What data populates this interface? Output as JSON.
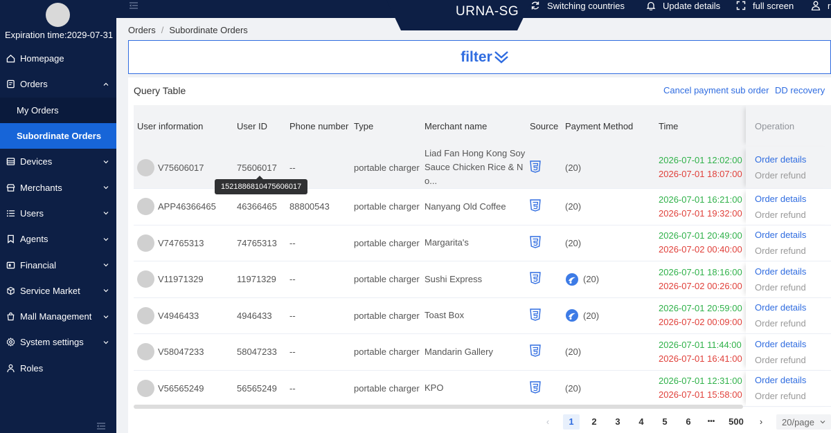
{
  "sidebar": {
    "expiration": "Expiration time:2029-07-31",
    "menu": [
      {
        "label": "Homepage"
      },
      {
        "label": "Orders"
      },
      {
        "label": "My Orders"
      },
      {
        "label": "Subordinate Orders"
      },
      {
        "label": "Devices"
      },
      {
        "label": "Merchants"
      },
      {
        "label": "Users"
      },
      {
        "label": "Agents"
      },
      {
        "label": "Financial"
      },
      {
        "label": "Service Market"
      },
      {
        "label": "Mall Management"
      },
      {
        "label": "System settings"
      },
      {
        "label": "Roles"
      }
    ]
  },
  "header": {
    "title": "URNA-SG",
    "switch_label": "Switching countries",
    "update_label": "Update details",
    "fullscreen_label": "full screen",
    "user_label": "r"
  },
  "breadcrumb": {
    "root": "Orders",
    "sep": "/",
    "current": "Subordinate Orders"
  },
  "filter": {
    "label": "filter"
  },
  "query": {
    "title": "Query Table",
    "cancel_payment": "Cancel payment sub order",
    "dd_recovery": "DD recovery"
  },
  "table": {
    "headers": [
      "User information",
      "User ID",
      "Phone number",
      "Type",
      "Merchant name",
      "Source",
      "Payment Method",
      "Time",
      "Operation"
    ],
    "rows": [
      {
        "user": "V75606017",
        "uid": "75606017",
        "phone": "--",
        "type": "portable charger",
        "merchant": "Liad Fan Hong Kong Soy Sauce Chicken Rice & No...",
        "pay": "(20)",
        "pay_icon": false,
        "t1": "2026-07-01 12:02:00",
        "t2": "2026-07-01 18:07:00",
        "op1": "Order details",
        "op2": "Order refund"
      },
      {
        "user": "APP46366465",
        "uid": "46366465",
        "phone": "88800543",
        "type": "portable charger",
        "merchant": "Nanyang Old Coffee",
        "pay": "(20)",
        "pay_icon": false,
        "t1": "2026-07-01 16:21:00",
        "t2": "2026-07-01 19:32:00",
        "op1": "Order details",
        "op2": "Order refund"
      },
      {
        "user": "V74765313",
        "uid": "74765313",
        "phone": "--",
        "type": "portable charger",
        "merchant": "Margarita's",
        "pay": "(20)",
        "pay_icon": false,
        "t1": "2026-07-01 20:49:00",
        "t2": "2026-07-02 00:40:00",
        "op1": "Order details",
        "op2": "Order refund"
      },
      {
        "user": "V11971329",
        "uid": "11971329",
        "phone": "--",
        "type": "portable charger",
        "merchant": "Sushi Express",
        "pay": "(20)",
        "pay_icon": true,
        "t1": "2026-07-01 18:16:00",
        "t2": "2026-07-02 00:26:00",
        "op1": "Order details",
        "op2": "Order refund"
      },
      {
        "user": "V4946433",
        "uid": "4946433",
        "phone": "--",
        "type": "portable charger",
        "merchant": "Toast Box",
        "pay": "(20)",
        "pay_icon": true,
        "t1": "2026-07-01 20:59:00",
        "t2": "2026-07-02 00:09:00",
        "op1": "Order details",
        "op2": "Order refund"
      },
      {
        "user": "V58047233",
        "uid": "58047233",
        "phone": "--",
        "type": "portable charger",
        "merchant": "Mandarin Gallery",
        "pay": "(20)",
        "pay_icon": false,
        "t1": "2026-07-01 11:44:00",
        "t2": "2026-07-01 16:41:00",
        "op1": "Order details",
        "op2": "Order refund"
      },
      {
        "user": "V56565249",
        "uid": "56565249",
        "phone": "--",
        "type": "portable charger",
        "merchant": "KPO",
        "pay": "(20)",
        "pay_icon": false,
        "t1": "2026-07-01 12:31:00",
        "t2": "2026-07-01 15:58:00",
        "op1": "Order details",
        "op2": "Order refund"
      }
    ]
  },
  "tooltip": "1521886810475606017",
  "pagination": {
    "prev": "‹",
    "pages": [
      "1",
      "2",
      "3",
      "4",
      "5",
      "6"
    ],
    "ellipsis": "•••",
    "last": "500",
    "next": "›",
    "current": "1",
    "page_size": "20/page"
  },
  "colors": {
    "sidebar": "#0d1f45",
    "accent": "#2f6ce0",
    "start_time": "#2fb149",
    "end_time": "#e0403a"
  }
}
